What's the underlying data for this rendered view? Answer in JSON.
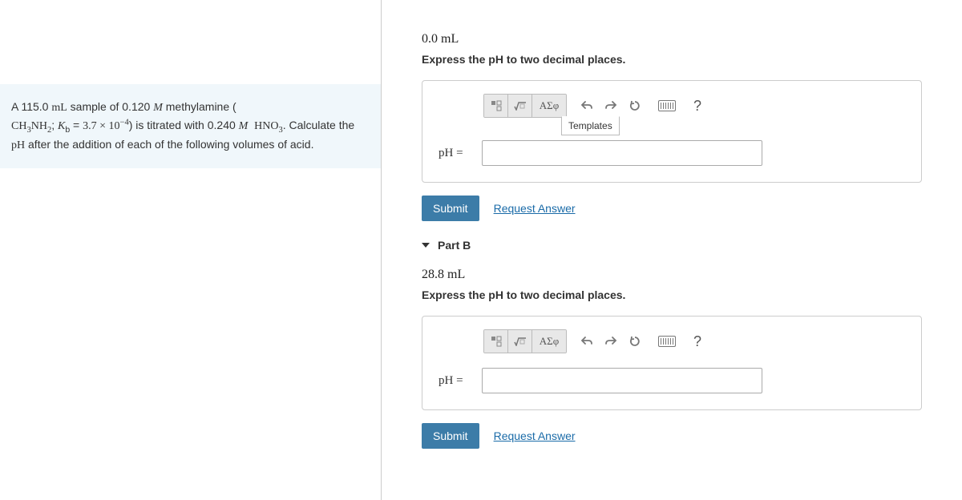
{
  "problem": {
    "line1_pre": "A 115.0 ",
    "line1_unit": "mL",
    "line1_mid": " sample of 0.120 ",
    "line1_M": "M",
    "line1_post": " methylamine (",
    "line2_formula": "CH₃NH₂",
    "line2_kb_label": "; K_b = ",
    "line2_kb_value": "3.7 × 10⁻⁴",
    "line2_mid": ") is titrated with 0.240 ",
    "line2_M": "M",
    "line2_acid": " HNO₃",
    "line2_end": ". Calculate the ",
    "line2_pH": "pH",
    "line2_after": " after the addition of each of the following volumes of acid."
  },
  "partA": {
    "volume": "0.0 mL",
    "instruction": "Express the pH to two decimal places.",
    "templates_label": "Templates",
    "greek_label": "ΑΣφ",
    "input_label": "pH =",
    "submit": "Submit",
    "request": "Request Answer",
    "help": "?"
  },
  "partB": {
    "title": "Part B",
    "volume": "28.8 mL",
    "instruction": "Express the pH to two decimal places.",
    "greek_label": "ΑΣφ",
    "input_label": "pH =",
    "submit": "Submit",
    "request": "Request Answer",
    "help": "?"
  }
}
